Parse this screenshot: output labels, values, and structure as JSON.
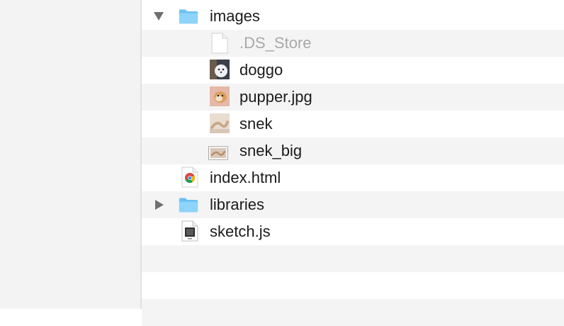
{
  "files": [
    {
      "name": "images",
      "kind": "folder",
      "expanded": true
    },
    {
      "name": ".DS_Store",
      "kind": "blank-file"
    },
    {
      "name": "doggo",
      "kind": "image"
    },
    {
      "name": "pupper.jpg",
      "kind": "image"
    },
    {
      "name": "snek",
      "kind": "image"
    },
    {
      "name": "snek_big",
      "kind": "image"
    },
    {
      "name": "index.html",
      "kind": "html-file"
    },
    {
      "name": "libraries",
      "kind": "folder",
      "expanded": false
    },
    {
      "name": "sketch.js",
      "kind": "js-file"
    }
  ],
  "colors": {
    "folder": "#78c8f5",
    "dimmed_text": "#a9a9a9",
    "alternate_row": "#f4f4f4"
  }
}
